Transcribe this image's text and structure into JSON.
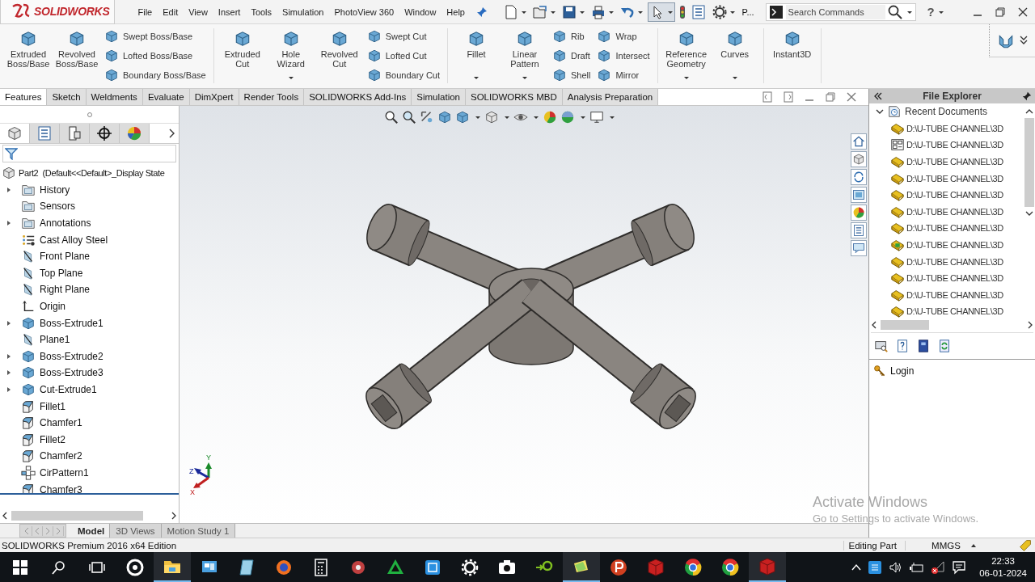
{
  "logo": {
    "text": "SOLIDWORKS"
  },
  "menu": [
    "File",
    "Edit",
    "View",
    "Insert",
    "Tools",
    "Simulation",
    "PhotoView 360",
    "Window",
    "Help"
  ],
  "quick_access": [
    {
      "kind": "new",
      "selected": false
    },
    {
      "kind": "open",
      "selected": false
    },
    {
      "kind": "save",
      "selected": false
    },
    {
      "kind": "print",
      "selected": false
    },
    {
      "kind": "undo",
      "selected": false
    },
    {
      "kind": "select",
      "selected": true
    },
    {
      "kind": "light",
      "selected": false
    },
    {
      "kind": "list",
      "selected": false
    },
    {
      "kind": "gear",
      "selected": false
    }
  ],
  "quick_more": "P...",
  "search": {
    "placeholder": "Search Commands"
  },
  "help": "?",
  "ribbon": [
    {
      "items": [
        {
          "kind": "large",
          "label": "Extruded Boss/Base",
          "dropdown": false
        },
        {
          "kind": "large",
          "label": "Revolved Boss/Base",
          "dropdown": false
        },
        {
          "kind": "stack",
          "items": [
            "Swept Boss/Base",
            "Lofted Boss/Base",
            "Boundary Boss/Base"
          ]
        }
      ]
    },
    {
      "items": [
        {
          "kind": "large",
          "label": "Extruded Cut",
          "dropdown": false
        },
        {
          "kind": "large",
          "label": "Hole Wizard",
          "dropdown": true
        },
        {
          "kind": "large",
          "label": "Revolved Cut",
          "dropdown": false
        },
        {
          "kind": "stack",
          "items": [
            "Swept Cut",
            "Lofted Cut",
            "Boundary Cut"
          ]
        }
      ]
    },
    {
      "items": [
        {
          "kind": "large",
          "label": "Fillet",
          "dropdown": true
        },
        {
          "kind": "large",
          "label": "Linear Pattern",
          "dropdown": true
        },
        {
          "kind": "stack",
          "items": [
            "Rib",
            "Draft",
            "Shell"
          ]
        },
        {
          "kind": "stack",
          "items": [
            "Wrap",
            "Intersect",
            "Mirror"
          ]
        }
      ]
    },
    {
      "items": [
        {
          "kind": "large",
          "label": "Reference Geometry",
          "dropdown": true
        },
        {
          "kind": "large",
          "label": "Curves",
          "dropdown": true
        }
      ]
    },
    {
      "items": [
        {
          "kind": "large",
          "label": "Instant3D",
          "dropdown": false
        }
      ]
    }
  ],
  "tabs": [
    {
      "label": "Features",
      "selected": true
    },
    {
      "label": "Sketch",
      "selected": false
    },
    {
      "label": "Weldments",
      "selected": false
    },
    {
      "label": "Evaluate",
      "selected": false
    },
    {
      "label": "DimXpert",
      "selected": false
    },
    {
      "label": "Render Tools",
      "selected": false
    },
    {
      "label": "SOLIDWORKS Add-Ins",
      "selected": false
    },
    {
      "label": "Simulation",
      "selected": false
    },
    {
      "label": "SOLIDWORKS MBD",
      "selected": false
    },
    {
      "label": "Analysis Preparation",
      "selected": false
    }
  ],
  "panel_tabs": [
    {
      "selected": true
    },
    {
      "selected": false
    },
    {
      "selected": false
    },
    {
      "selected": false
    },
    {
      "selected": false
    }
  ],
  "tree": {
    "label": "Part2  (Default<<Default>_Display State",
    "kind": "part",
    "children": [
      {
        "label": "History",
        "kind": "folder",
        "expandable": true
      },
      {
        "label": "Sensors",
        "kind": "folder",
        "expandable": false
      },
      {
        "label": "Annotations",
        "kind": "folder",
        "expandable": true
      },
      {
        "label": "Cast Alloy Steel",
        "kind": "material",
        "expandable": false
      },
      {
        "label": "Front Plane",
        "kind": "plane",
        "expandable": false
      },
      {
        "label": "Top Plane",
        "kind": "plane",
        "expandable": false
      },
      {
        "label": "Right Plane",
        "kind": "plane",
        "expandable": false
      },
      {
        "label": "Origin",
        "kind": "origin",
        "expandable": false
      },
      {
        "label": "Boss-Extrude1",
        "kind": "feature",
        "expandable": true
      },
      {
        "label": "Plane1",
        "kind": "plane",
        "expandable": false
      },
      {
        "label": "Boss-Extrude2",
        "kind": "feature",
        "expandable": true
      },
      {
        "label": "Boss-Extrude3",
        "kind": "feature",
        "expandable": true
      },
      {
        "label": "Cut-Extrude1",
        "kind": "feature",
        "expandable": true
      },
      {
        "label": "Fillet1",
        "kind": "fillet",
        "expandable": false
      },
      {
        "label": "Chamfer1",
        "kind": "fillet",
        "expandable": false
      },
      {
        "label": "Fillet2",
        "kind": "fillet",
        "expandable": false
      },
      {
        "label": "Chamfer2",
        "kind": "fillet",
        "expandable": false
      },
      {
        "label": "CirPattern1",
        "kind": "pattern",
        "expandable": false
      },
      {
        "label": "Chamfer3",
        "kind": "fillet",
        "expandable": false
      }
    ]
  },
  "triad": {
    "x": "X",
    "y": "Y",
    "z": "Z"
  },
  "model_tabs": [
    {
      "label": "Model",
      "selected": true
    },
    {
      "label": "3D Views",
      "selected": false
    },
    {
      "label": "Motion Study 1",
      "selected": false
    }
  ],
  "file_explorer": {
    "title": "File Explorer",
    "root": {
      "label": "Recent Documents",
      "expanded": true,
      "children": [
        {
          "label": "D:\\U-TUBE CHANNEL\\3D",
          "kind": "part"
        },
        {
          "label": "D:\\U-TUBE CHANNEL\\3D",
          "kind": "drawing"
        },
        {
          "label": "D:\\U-TUBE CHANNEL\\3D",
          "kind": "part"
        },
        {
          "label": "D:\\U-TUBE CHANNEL\\3D",
          "kind": "part"
        },
        {
          "label": "D:\\U-TUBE CHANNEL\\3D",
          "kind": "part"
        },
        {
          "label": "D:\\U-TUBE CHANNEL\\3D",
          "kind": "part"
        },
        {
          "label": "D:\\U-TUBE CHANNEL\\3D",
          "kind": "part"
        },
        {
          "label": "D:\\U-TUBE CHANNEL\\3D",
          "kind": "assembly"
        },
        {
          "label": "D:\\U-TUBE CHANNEL\\3D",
          "kind": "part"
        },
        {
          "label": "D:\\U-TUBE CHANNEL\\3D",
          "kind": "part"
        },
        {
          "label": "D:\\U-TUBE CHANNEL\\3D",
          "kind": "part"
        },
        {
          "label": "D:\\U-TUBE CHANNEL\\3D",
          "kind": "part"
        }
      ]
    },
    "login": "Login"
  },
  "activation": {
    "title": "Activate Windows",
    "hint": "Go to Settings to activate Windows."
  },
  "status_bar": {
    "edition": "SOLIDWORKS Premium 2016 x64 Edition",
    "mode": "Editing Part",
    "units": "MMGS"
  },
  "taskbar": {
    "apps": [
      {
        "kind": "cortana",
        "running": false
      },
      {
        "kind": "explorer",
        "running": true
      },
      {
        "kind": "monitor",
        "running": false
      },
      {
        "kind": "notes",
        "running": false
      },
      {
        "kind": "firefox",
        "running": false
      },
      {
        "kind": "calc",
        "running": false
      },
      {
        "kind": "gear",
        "running": false
      },
      {
        "kind": "triangle",
        "running": false
      },
      {
        "kind": "snip",
        "running": false
      },
      {
        "kind": "settings",
        "running": false
      },
      {
        "kind": "camera",
        "running": false
      },
      {
        "kind": "edraw",
        "running": false
      },
      {
        "kind": "sticky",
        "running": true
      },
      {
        "kind": "psiphon",
        "running": false
      },
      {
        "kind": "sw",
        "running": false
      },
      {
        "kind": "chrome",
        "running": false
      },
      {
        "kind": "chrome",
        "running": false
      },
      {
        "kind": "sw",
        "running": true
      }
    ],
    "time": "22:33",
    "date": "06-01-2024"
  }
}
